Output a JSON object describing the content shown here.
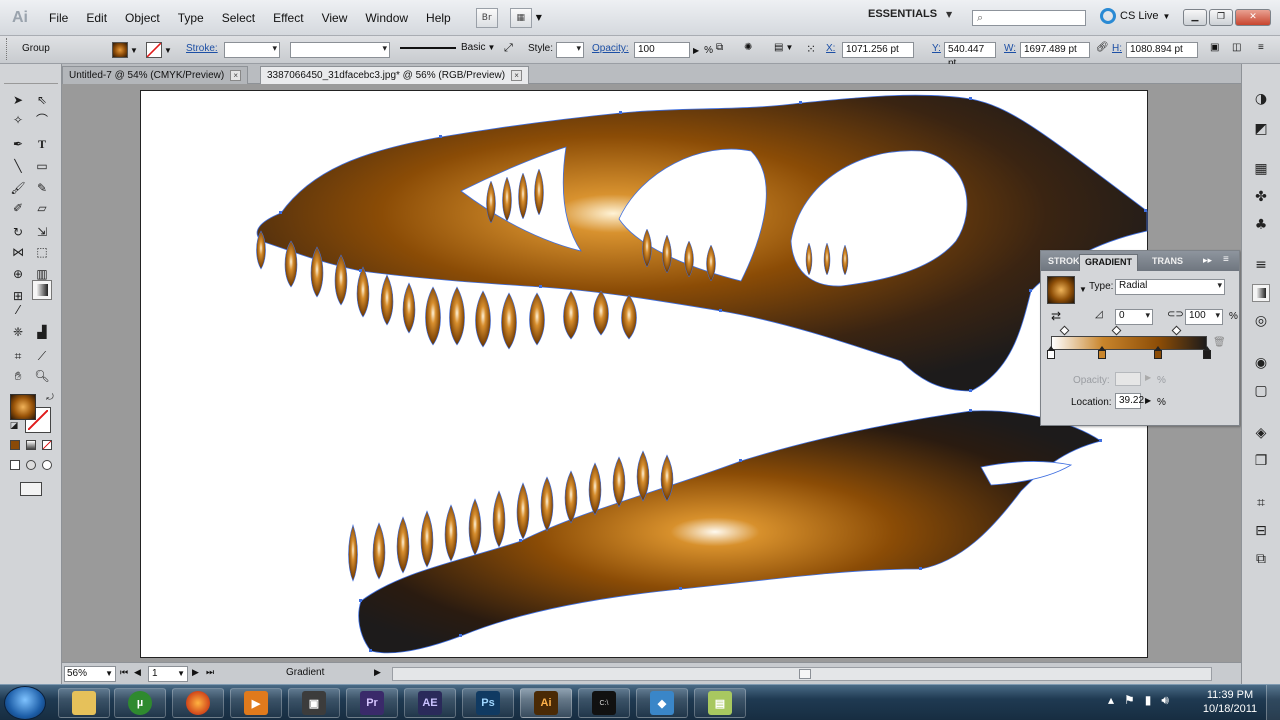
{
  "app": {
    "logo": "Ai",
    "menu": [
      "File",
      "Edit",
      "Object",
      "Type",
      "Select",
      "Effect",
      "View",
      "Window",
      "Help"
    ],
    "bridge_label": "Br",
    "workspace": "ESSENTIALS",
    "cs_live": "CS Live"
  },
  "control_bar": {
    "selection": "Group",
    "stroke_label": "Stroke:",
    "brush_label": "Basic",
    "style_label": "Style:",
    "opacity_label": "Opacity:",
    "opacity_value": "100",
    "opacity_unit": "%",
    "x_label": "X:",
    "x_value": "1071.256 pt",
    "y_label": "Y:",
    "y_value": "540.447 pt",
    "w_label": "W:",
    "w_value": "1697.489 pt",
    "h_label": "H:",
    "h_value": "1080.894 pt"
  },
  "doc_tabs": [
    {
      "label": "Untitled-7 @ 54% (CMYK/Preview)",
      "active": false
    },
    {
      "label": "3387066450_31dfacebc3.jpg* @ 56% (RGB/Preview)",
      "active": true
    }
  ],
  "gradient_panel": {
    "tabs": [
      "STROKE",
      "GRADIENT",
      "TRANS"
    ],
    "type_label": "Type:",
    "type_value": "Radial",
    "angle_value": "0",
    "aspect_value": "100",
    "aspect_unit": "%",
    "opacity_label": "Opacity:",
    "opacity_unit": "%",
    "location_label": "Location:",
    "location_value": "39.22",
    "location_unit": "%",
    "stops": [
      {
        "color": "#ffffff"
      },
      {
        "color": "#c9852b"
      },
      {
        "color": "#8b4c06"
      },
      {
        "color": "#1d1b1b"
      }
    ]
  },
  "status_bar": {
    "zoom": "56%",
    "artboard": "1",
    "tool_name": "Gradient"
  },
  "taskbar": {
    "time": "11:39 PM",
    "date": "10/18/2011",
    "apps": [
      {
        "name": "explorer",
        "label": ""
      },
      {
        "name": "utorrent",
        "label": ""
      },
      {
        "name": "firefox",
        "label": ""
      },
      {
        "name": "media-player",
        "label": ""
      },
      {
        "name": "camtasia",
        "label": ""
      },
      {
        "name": "premiere",
        "label": "Pr"
      },
      {
        "name": "after-effects",
        "label": "AE"
      },
      {
        "name": "photoshop",
        "label": "Ps"
      },
      {
        "name": "illustrator",
        "label": "Ai"
      },
      {
        "name": "command-prompt",
        "label": "C:\\"
      },
      {
        "name": "virtualbox",
        "label": ""
      },
      {
        "name": "notes",
        "label": ""
      }
    ]
  },
  "colors": {
    "gradient_light": "#ffffff",
    "gradient_mid": "#c9852b",
    "gradient_brown": "#8b4c06",
    "gradient_dark": "#1d1b1b",
    "selection_blue": "#3f6fe0"
  }
}
